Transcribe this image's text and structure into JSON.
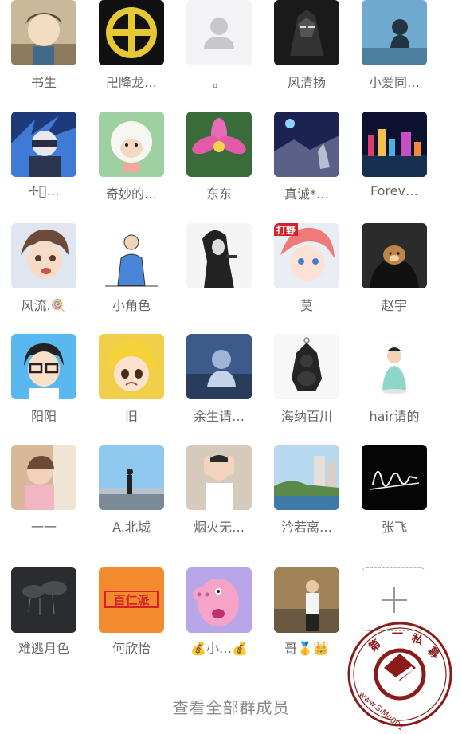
{
  "members": [
    {
      "name": "书生"
    },
    {
      "name": "卍降龙…"
    },
    {
      "name": "。"
    },
    {
      "name": "风清扬"
    },
    {
      "name": "小爱同…"
    },
    {
      "name": "✢ꦿ…"
    },
    {
      "name": "奇妙的…"
    },
    {
      "name": "东东"
    },
    {
      "name": "真诚*…"
    },
    {
      "name": "Forev…"
    },
    {
      "name": "风流.🍭"
    },
    {
      "name": "小角色"
    },
    {
      "name": ""
    },
    {
      "name": "莫"
    },
    {
      "name": "赵宇"
    },
    {
      "name": "阳阳"
    },
    {
      "name": "旧"
    },
    {
      "name": "余生请…"
    },
    {
      "name": "海纳百川"
    },
    {
      "name": "hair请的"
    },
    {
      "name": "一一"
    },
    {
      "name": "A.北城"
    },
    {
      "name": "烟火无…"
    },
    {
      "name": "汵若离…"
    },
    {
      "name": "张飞"
    },
    {
      "name": "难逃月色"
    },
    {
      "name": "何欣怡"
    },
    {
      "name": "💰小…💰"
    },
    {
      "name": "哥🥇👑"
    }
  ],
  "avatar_texts": {
    "mo_badge": "打野",
    "hexinyi_logo": "百仁派"
  },
  "add_button": {
    "label": "+"
  },
  "footer": {
    "view_all": "查看全部群成员"
  },
  "watermark": {
    "top_chars": "第一私募",
    "url": "www.SiMu001.cn"
  },
  "colors": {
    "name_text": "#666666",
    "footer_text": "#8a8a8a",
    "watermark": "#8b1a1a"
  }
}
